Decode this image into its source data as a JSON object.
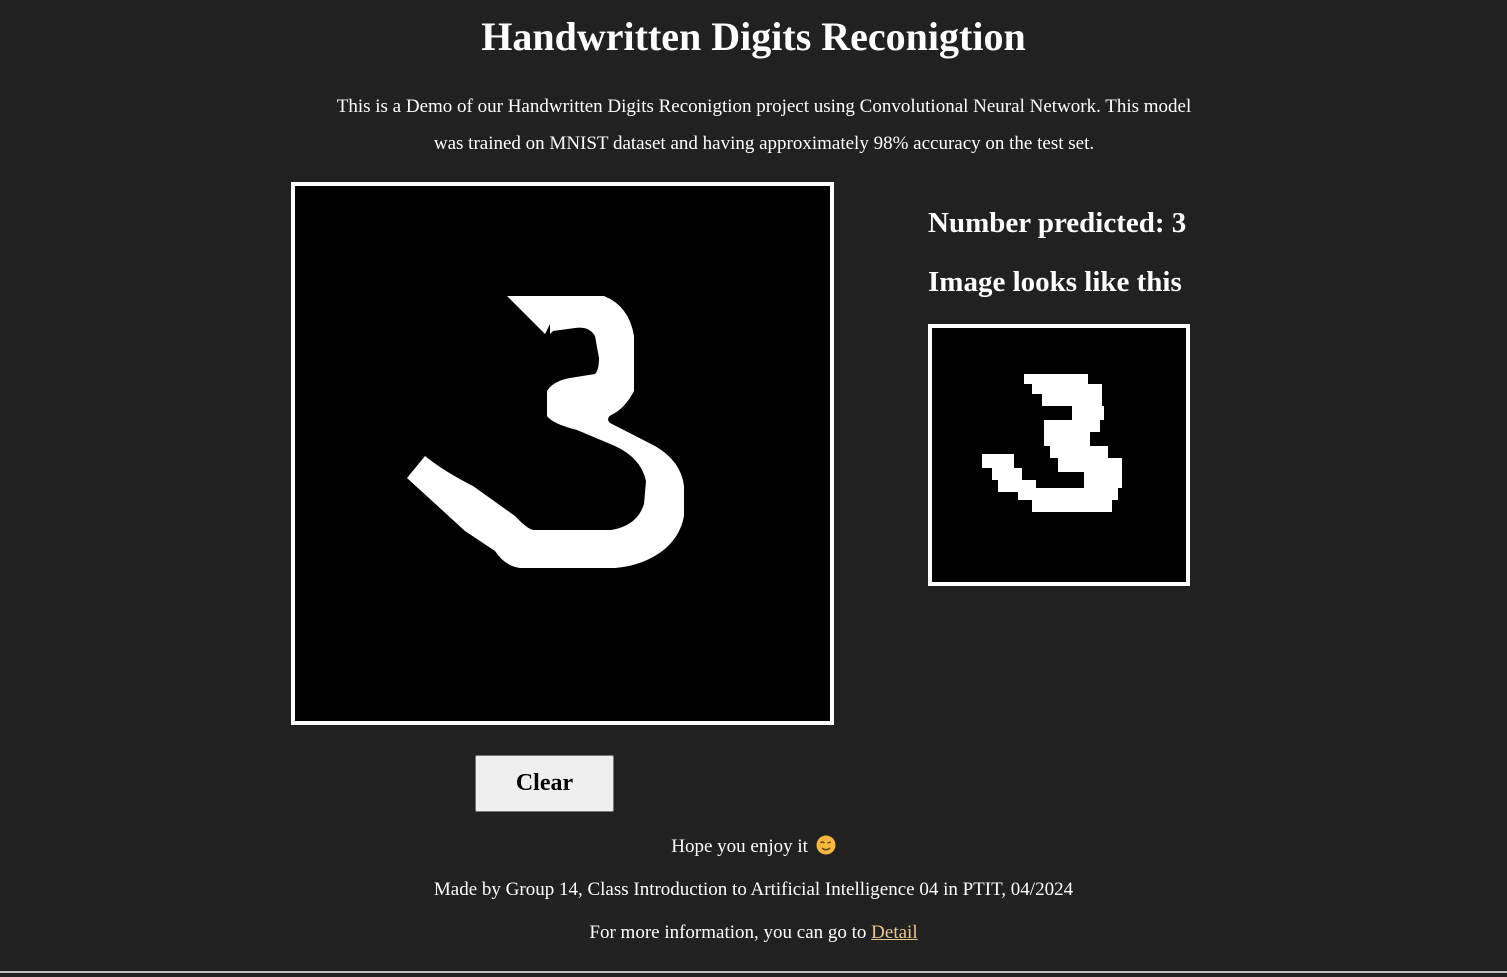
{
  "header": {
    "title": "Handwritten Digits Reconigtion"
  },
  "intro": {
    "text": "This is a Demo of our Handwritten Digits Reconigtion project using Convolutional Neural Network. This model was trained on MNIST dataset and having approximately 98% accuracy on the test set."
  },
  "canvas": {
    "drawn_digit": "3"
  },
  "controls": {
    "clear_label": "Clear"
  },
  "result": {
    "predicted_text": "Number predicted: 3",
    "preview_heading": "Image looks like this"
  },
  "footer": {
    "enjoy_text": "Hope you enjoy it",
    "enjoy_emoji_icon": "winking-face-icon",
    "credit_text": "Made by Group 14, Class Introduction to Artificial Intelligence 04 in PTIT, 04/2024",
    "more_info_prefix": "For more information, you can go to ",
    "detail_link_label": "Detail"
  },
  "colors": {
    "background": "#212121",
    "link": "#e9c58f",
    "canvas": "#000000",
    "stroke": "#ffffff"
  }
}
